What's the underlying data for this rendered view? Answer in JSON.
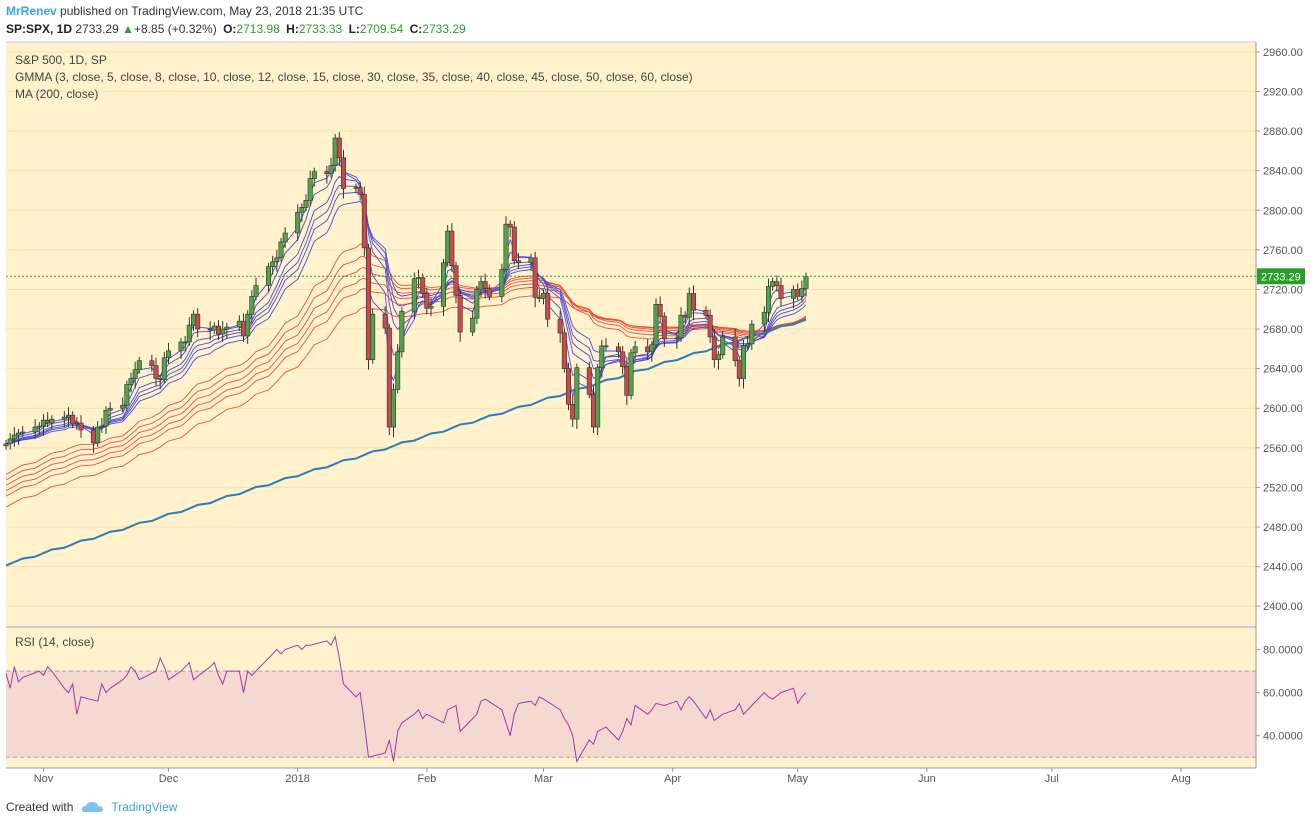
{
  "header": {
    "author": "MrRenev",
    "published": "published on TradingView.com, May 23, 2018 21:35 UTC",
    "symbol": "SP:SPX, 1D",
    "last": "2733.29",
    "change": "+8.85 (+0.32%)",
    "open_label": "O:",
    "open": "2713.98",
    "high_label": "H:",
    "high": "2733.33",
    "low_label": "L:",
    "low": "2709.54",
    "close_label": "C:",
    "close": "2733.29"
  },
  "legend": {
    "title": "S&P 500, 1D, SP",
    "gmma": "GMMA (3, close, 5, close, 8, close, 10, close, 12, close, 15, close, 30, close, 35, close, 40, close, 45, close, 50, close, 60, close)",
    "ma": "MA (200, close)",
    "rsi": "RSI (14, close)"
  },
  "footer": {
    "created": "Created with",
    "brand": "TradingView"
  },
  "colors": {
    "background": "#fff2cc",
    "up": "#53a24a",
    "down": "#c94a4a",
    "short_ema": "#4b4bdc",
    "long_ema": "#e8513a",
    "ma200": "#2c7db8",
    "rsi": "#9c3bb0",
    "rsi_band": "#f5d8d0",
    "price_line": "#2a9d2a"
  },
  "chart_data": {
    "type": "candlestick",
    "title": "S&P 500, 1D, SP",
    "last_price": 2733.29,
    "ylim": [
      2380,
      2970
    ],
    "y_ticks": [
      "2960.00",
      "2920.00",
      "2880.00",
      "2840.00",
      "2800.00",
      "2760.00",
      "2720.00",
      "2680.00",
      "2640.00",
      "2600.00",
      "2560.00",
      "2520.00",
      "2480.00",
      "2440.00",
      "2400.00"
    ],
    "y_tick_values": [
      2960,
      2920,
      2880,
      2840,
      2800,
      2760,
      2720,
      2680,
      2640,
      2600,
      2560,
      2520,
      2480,
      2440,
      2400
    ],
    "x_ticks": [
      "Nov",
      "Dec",
      "2018",
      "Feb",
      "Mar",
      "Apr",
      "May",
      "Jun",
      "Jul",
      "Aug"
    ],
    "x_tick_days": [
      -61,
      -31,
      0,
      31,
      59,
      90,
      120,
      151,
      181,
      212
    ],
    "x_range_days": [
      -70,
      230
    ],
    "start_date": "2017-10-23",
    "closes": [
      2564,
      2569,
      2573,
      2575,
      2576,
      2581,
      2582,
      2588,
      2585,
      2589,
      2591,
      2593,
      2584,
      2585,
      2578,
      2565,
      2581,
      2582,
      2598,
      2600,
      2603,
      2624,
      2630,
      2639,
      2648,
      2643,
      2630,
      2629,
      2651,
      2658,
      2667,
      2667,
      2684,
      2695,
      2680,
      2679,
      2683,
      2675,
      2680,
      2682,
      2688,
      2673,
      2695,
      2713,
      2724,
      2743,
      2748,
      2752,
      2768,
      2777,
      2798,
      2803,
      2810,
      2832,
      2839,
      2837,
      2845,
      2873,
      2853,
      2822,
      2823,
      2816,
      2762,
      2649,
      2695,
      2681,
      2581,
      2619,
      2657,
      2698,
      2731,
      2732,
      2716,
      2701,
      2703,
      2747,
      2779,
      2744,
      2714,
      2677,
      2691,
      2720,
      2728,
      2721,
      2713,
      2740,
      2786,
      2783,
      2749,
      2747,
      2752,
      2712,
      2711,
      2716,
      2690,
      2676,
      2640,
      2604,
      2589,
      2641,
      2614,
      2581,
      2641,
      2663,
      2662,
      2657,
      2642,
      2613,
      2656,
      2662,
      2657,
      2664,
      2705,
      2693,
      2670,
      2671,
      2694,
      2692,
      2716,
      2699,
      2694,
      2672,
      2649,
      2654,
      2672,
      2648,
      2630,
      2663,
      2665,
      2685,
      2697,
      2723,
      2728,
      2724,
      2711,
      2720,
      2713,
      2721,
      2733
    ],
    "ma200": [
      2441,
      2690
    ],
    "rsi_ticks": [
      "80.0000",
      "60.0000",
      "40.0000"
    ],
    "rsi_tick_values": [
      80,
      60,
      40
    ],
    "rsi_band": [
      30,
      70
    ],
    "rsi_ylim": [
      25,
      90
    ],
    "rsi": [
      69,
      62,
      72,
      65,
      67,
      70,
      68,
      72,
      70,
      62,
      60,
      64,
      50,
      58,
      56,
      64,
      60,
      62,
      66,
      68,
      72,
      70,
      66,
      70,
      76,
      72,
      66,
      70,
      72,
      74,
      66,
      72,
      74,
      68,
      64,
      70,
      70,
      60,
      70,
      68,
      76,
      78,
      80,
      78,
      80,
      82,
      80,
      82,
      82,
      84,
      82,
      86,
      76,
      64,
      58,
      60,
      46,
      30,
      32,
      38,
      28,
      42,
      46,
      50,
      52,
      48,
      50,
      46,
      52,
      53,
      54,
      42,
      48,
      50,
      56,
      57,
      52,
      46,
      40,
      50,
      55,
      56,
      54,
      58,
      57,
      52,
      48,
      45,
      40,
      28,
      38,
      36,
      42,
      44,
      38,
      42,
      48,
      45,
      54,
      50,
      52,
      55,
      54,
      56,
      52,
      56,
      58,
      56,
      48,
      52,
      47,
      50,
      52,
      55,
      50,
      52,
      54,
      60,
      58,
      57,
      60,
      62,
      55,
      58,
      60
    ]
  }
}
